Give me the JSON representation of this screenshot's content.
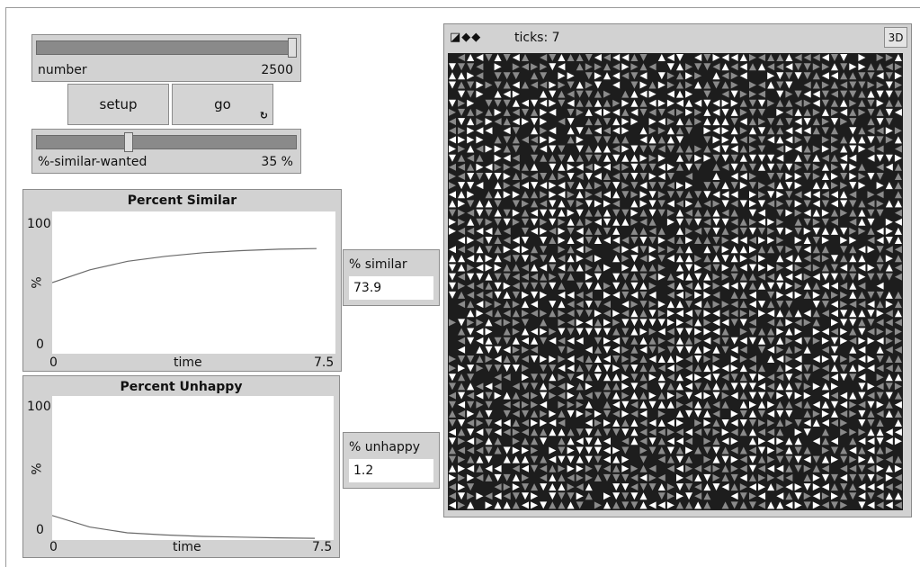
{
  "sliders": {
    "number": {
      "label": "number",
      "value": "2500",
      "fraction": 1.0
    },
    "similar_wanted": {
      "label": "%-similar-wanted",
      "value": "35 %",
      "fraction": 0.35
    }
  },
  "buttons": {
    "setup": "setup",
    "go": "go",
    "forever_icon": "↻"
  },
  "plots": {
    "similar": {
      "title": "Percent Similar",
      "ymax": "100",
      "ymin": "0",
      "ylabel": "%",
      "xmin": "0",
      "xmax": "7.5",
      "xlabel": "time"
    },
    "unhappy": {
      "title": "Percent Unhappy",
      "ymax": "100",
      "ymin": "0",
      "ylabel": "%",
      "xmin": "0",
      "xmax": "7.5",
      "xlabel": "time"
    }
  },
  "monitors": {
    "similar": {
      "label": "% similar",
      "value": "73.9"
    },
    "unhappy": {
      "label": "% unhappy",
      "value": "1.2"
    }
  },
  "view": {
    "toolbar_icons": "◪◆◆",
    "ticks": "ticks: 7",
    "three_d": "3D"
  },
  "chart_data": [
    {
      "type": "line",
      "title": "Percent Similar",
      "xlabel": "time",
      "ylabel": "%",
      "xlim": [
        0,
        7.5
      ],
      "ylim": [
        0,
        100
      ],
      "series": [
        {
          "x": [
            0,
            1,
            2,
            3,
            4,
            5,
            6,
            7
          ],
          "values": [
            50,
            59,
            65,
            68.5,
            71,
            72.5,
            73.5,
            73.9
          ]
        }
      ]
    },
    {
      "type": "line",
      "title": "Percent Unhappy",
      "xlabel": "time",
      "ylabel": "%",
      "xlim": [
        0,
        7.5
      ],
      "ylim": [
        0,
        100
      ],
      "series": [
        {
          "x": [
            0,
            1,
            2,
            3,
            4,
            5,
            6,
            7
          ],
          "values": [
            17,
            9,
            5,
            3.5,
            2.5,
            2,
            1.5,
            1.2
          ]
        }
      ]
    }
  ]
}
